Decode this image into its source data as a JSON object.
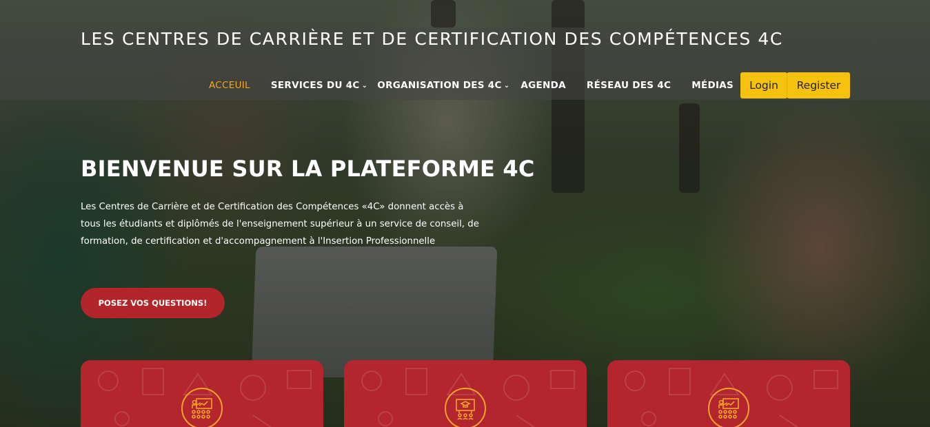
{
  "header": {
    "site_title": "LES CENTRES DE CARRIÈRE ET DE CERTIFICATION DES COMPÉTENCES 4C"
  },
  "nav": {
    "items": [
      {
        "label": "ACCEUIL",
        "active": true
      },
      {
        "label": "SERVICES DU 4C",
        "dropdown": true
      },
      {
        "label": "ORGANISATION DES 4C",
        "dropdown": true
      },
      {
        "label": "AGENDA"
      },
      {
        "label": "RÉSEAU DES 4C"
      },
      {
        "label": "MÉDIAS"
      }
    ],
    "login_label": "Login",
    "register_label": "Register"
  },
  "hero": {
    "title": "BIENVENUE SUR LA PLATEFORME 4C",
    "description": "Les Centres de Carrière et de Certification des Compétences «4C» donnent accès à tous les étudiants et diplômés de l'enseignement supérieur à un service de conseil, de formation, de certification et d'accompagnement à l'Insertion Professionnelle",
    "cta_label": "POSEZ VOS QUESTIONS!"
  },
  "cards": [
    {
      "icon": "presentation-teacher-icon"
    },
    {
      "icon": "graduation-board-icon"
    },
    {
      "icon": "presentation-teacher-icon"
    }
  ],
  "colors": {
    "accent_orange": "#f4a521",
    "login_yellow": "#f6c20f",
    "brand_red": "#b2252a"
  }
}
